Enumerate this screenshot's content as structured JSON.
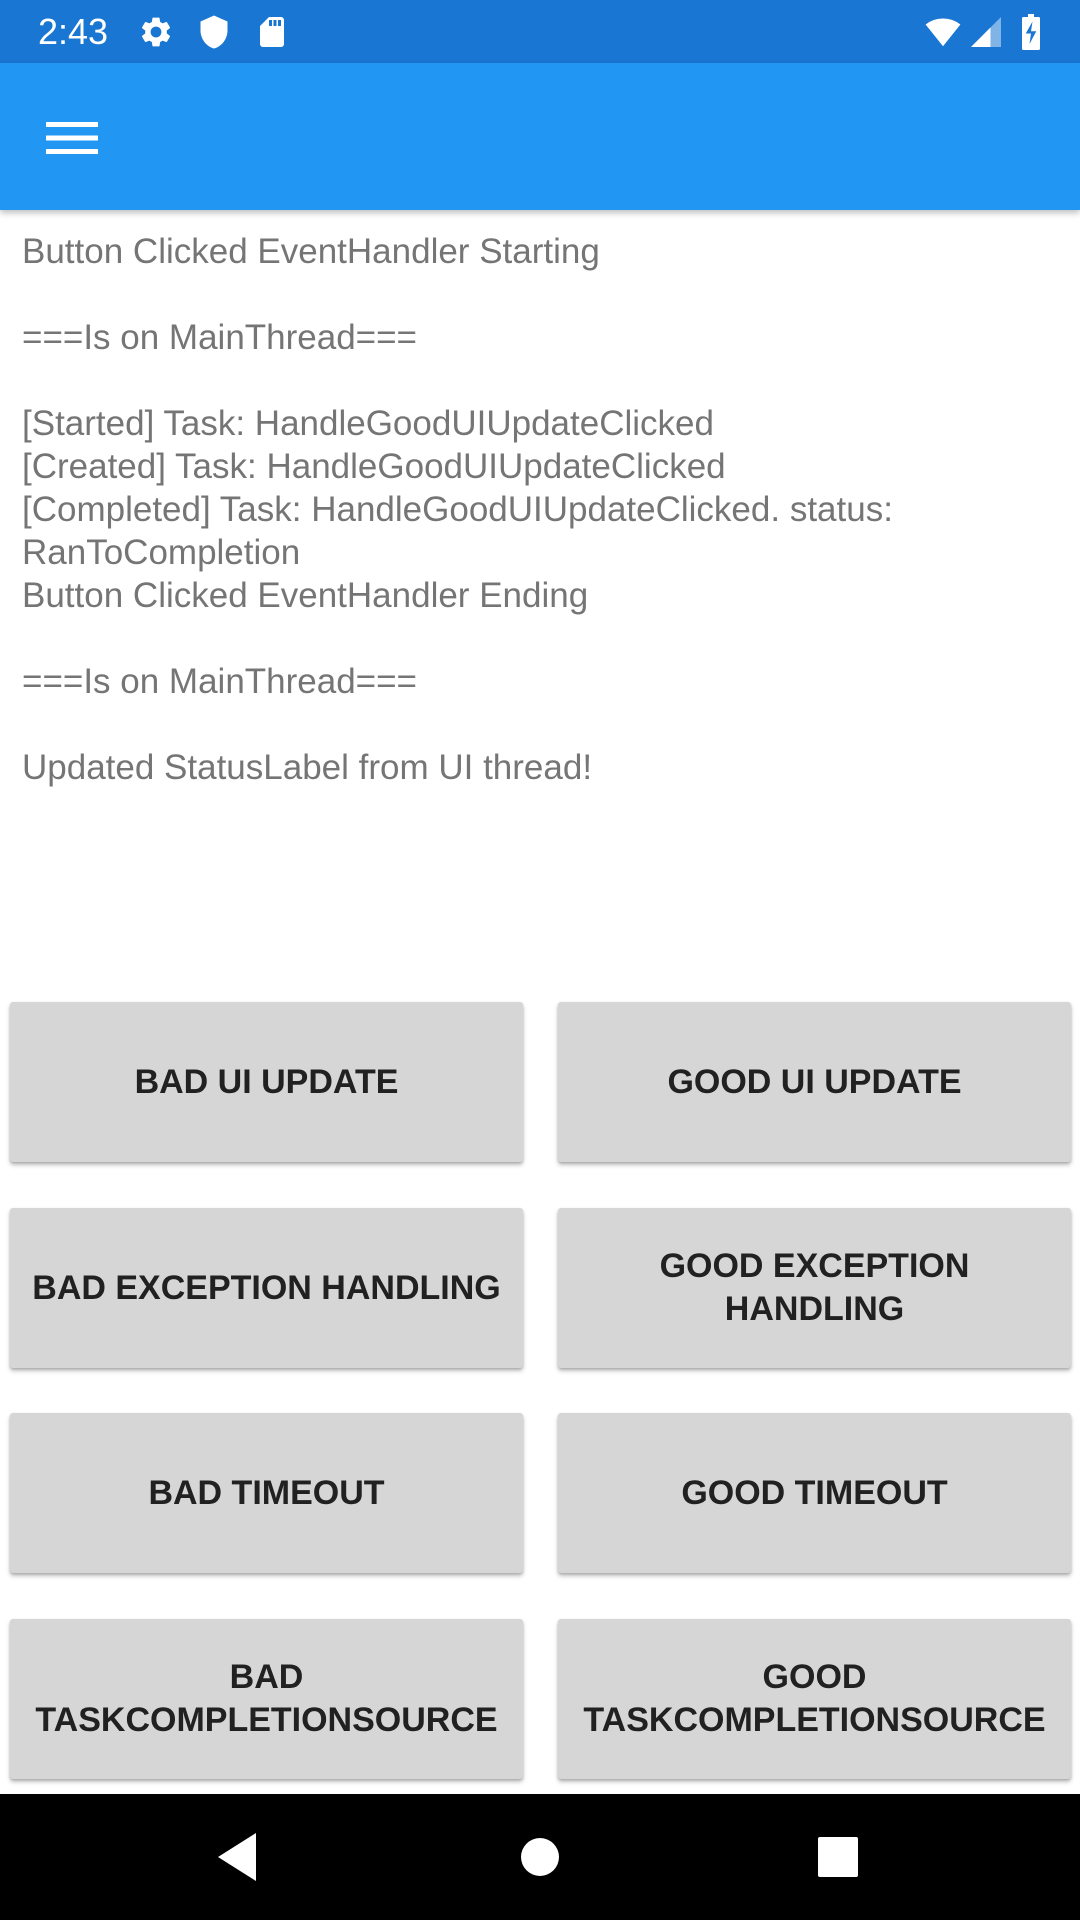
{
  "status_bar": {
    "time": "2:43",
    "left_icons": [
      "gear-icon",
      "shield-icon",
      "sd-card-icon"
    ],
    "right_icons": [
      "wifi-icon",
      "cell-signal-icon",
      "battery-charging-icon"
    ]
  },
  "app_bar": {
    "menu_icon": "hamburger-menu-icon",
    "color": "#2196f3"
  },
  "log": {
    "lines": [
      "Button Clicked EventHandler Starting",
      "",
      "===Is on MainThread===",
      "",
      "[Started] Task: HandleGoodUIUpdateClicked",
      "[Created] Task: HandleGoodUIUpdateClicked",
      "[Completed] Task: HandleGoodUIUpdateClicked. status: RanToCompletion",
      "Button Clicked EventHandler Ending",
      "",
      "===Is on MainThread===",
      "",
      "Updated StatusLabel from UI thread!"
    ]
  },
  "buttons": {
    "bad_ui_update": "BAD UI UPDATE",
    "good_ui_update": "GOOD UI UPDATE",
    "bad_exception_handling": "BAD EXCEPTION HANDLING",
    "good_exception_handling": "GOOD EXCEPTION HANDLING",
    "bad_timeout": "BAD TIMEOUT",
    "good_timeout": "GOOD TIMEOUT",
    "bad_tcs": "BAD TASKCOMPLETIONSOURCE",
    "good_tcs": "GOOD TASKCOMPLETIONSOURCE"
  },
  "nav_bar": {
    "icons": [
      "back-icon",
      "home-icon",
      "recents-icon"
    ]
  }
}
